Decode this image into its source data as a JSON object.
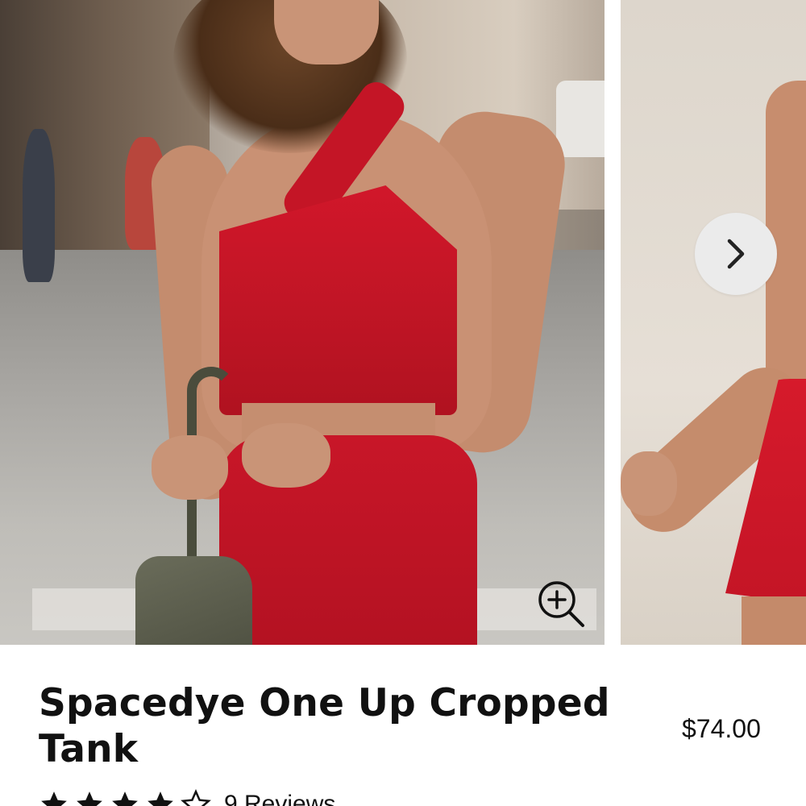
{
  "gallery": {
    "images": [
      {
        "alt": "Model wearing red one-shoulder cropped tank and shorts on a city street"
      },
      {
        "alt": "Model wearing red dress"
      }
    ],
    "next_icon": "chevron-right-icon",
    "zoom_icon": "zoom-in-icon"
  },
  "product": {
    "title": "Spacedye One Up Cropped Tank",
    "price": "$74.00",
    "rating": 4,
    "rating_max": 5,
    "reviews_label": "9 Reviews"
  },
  "colors": {
    "text": "#111111",
    "control_bg": "#ebebeb",
    "product_red": "#c41526"
  }
}
